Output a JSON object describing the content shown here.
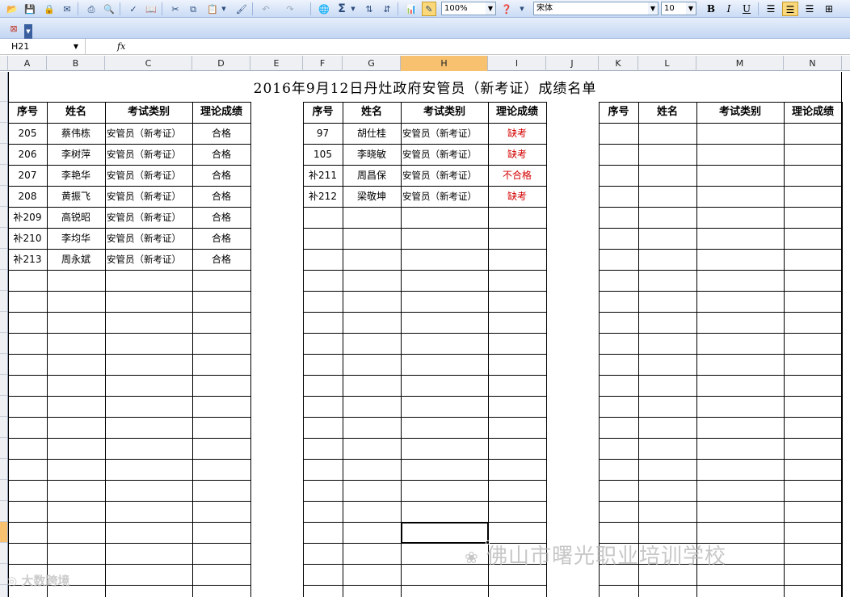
{
  "toolbar": {
    "zoom": "100%",
    "font_name": "宋体",
    "font_size": "10",
    "bold_label": "B",
    "italic_label": "I",
    "underline_label": "U",
    "sum_label": "Σ"
  },
  "formula_bar": {
    "name_box": "H21",
    "fx_label": "fx",
    "formula": ""
  },
  "columns": [
    "A",
    "B",
    "C",
    "D",
    "E",
    "F",
    "G",
    "H",
    "I",
    "J",
    "K",
    "L",
    "M",
    "N"
  ],
  "selected_column": "H",
  "sheet": {
    "title": "2016年9月12日丹灶政府安管员（新考证）成绩名单",
    "headers": [
      "序号",
      "姓名",
      "考试类别",
      "理论成绩"
    ],
    "table1": [
      {
        "no": "205",
        "name": "蔡伟栋",
        "type": "安管员（新考证）",
        "score": "合格"
      },
      {
        "no": "206",
        "name": "李树萍",
        "type": "安管员（新考证）",
        "score": "合格"
      },
      {
        "no": "207",
        "name": "李艳华",
        "type": "安管员（新考证）",
        "score": "合格"
      },
      {
        "no": "208",
        "name": "黄振飞",
        "type": "安管员（新考证）",
        "score": "合格"
      },
      {
        "no": "补209",
        "name": "高锐昭",
        "type": "安管员（新考证）",
        "score": "合格"
      },
      {
        "no": "补210",
        "name": "李均华",
        "type": "安管员（新考证）",
        "score": "合格"
      },
      {
        "no": "补213",
        "name": "周永斌",
        "type": "安管员（新考证）",
        "score": "合格"
      }
    ],
    "table2": [
      {
        "no": "97",
        "name": "胡仕桂",
        "type": "安管员（新考证）",
        "score": "缺考"
      },
      {
        "no": "105",
        "name": "李晓敏",
        "type": "安管员（新考证）",
        "score": "缺考"
      },
      {
        "no": "补211",
        "name": "周昌保",
        "type": "安管员（新考证）",
        "score": "不合格"
      },
      {
        "no": "补212",
        "name": "梁敬坤",
        "type": "安管员（新考证）",
        "score": "缺考"
      }
    ]
  },
  "watermarks": {
    "school": "佛山市曙光职业培训学校",
    "brand": "大数跨境"
  },
  "colors": {
    "fail_text": "#d40000",
    "selected_header": "#f7c170",
    "toolbar_top": "#eef3fc",
    "toolbar_bottom": "#c9dbf5"
  }
}
